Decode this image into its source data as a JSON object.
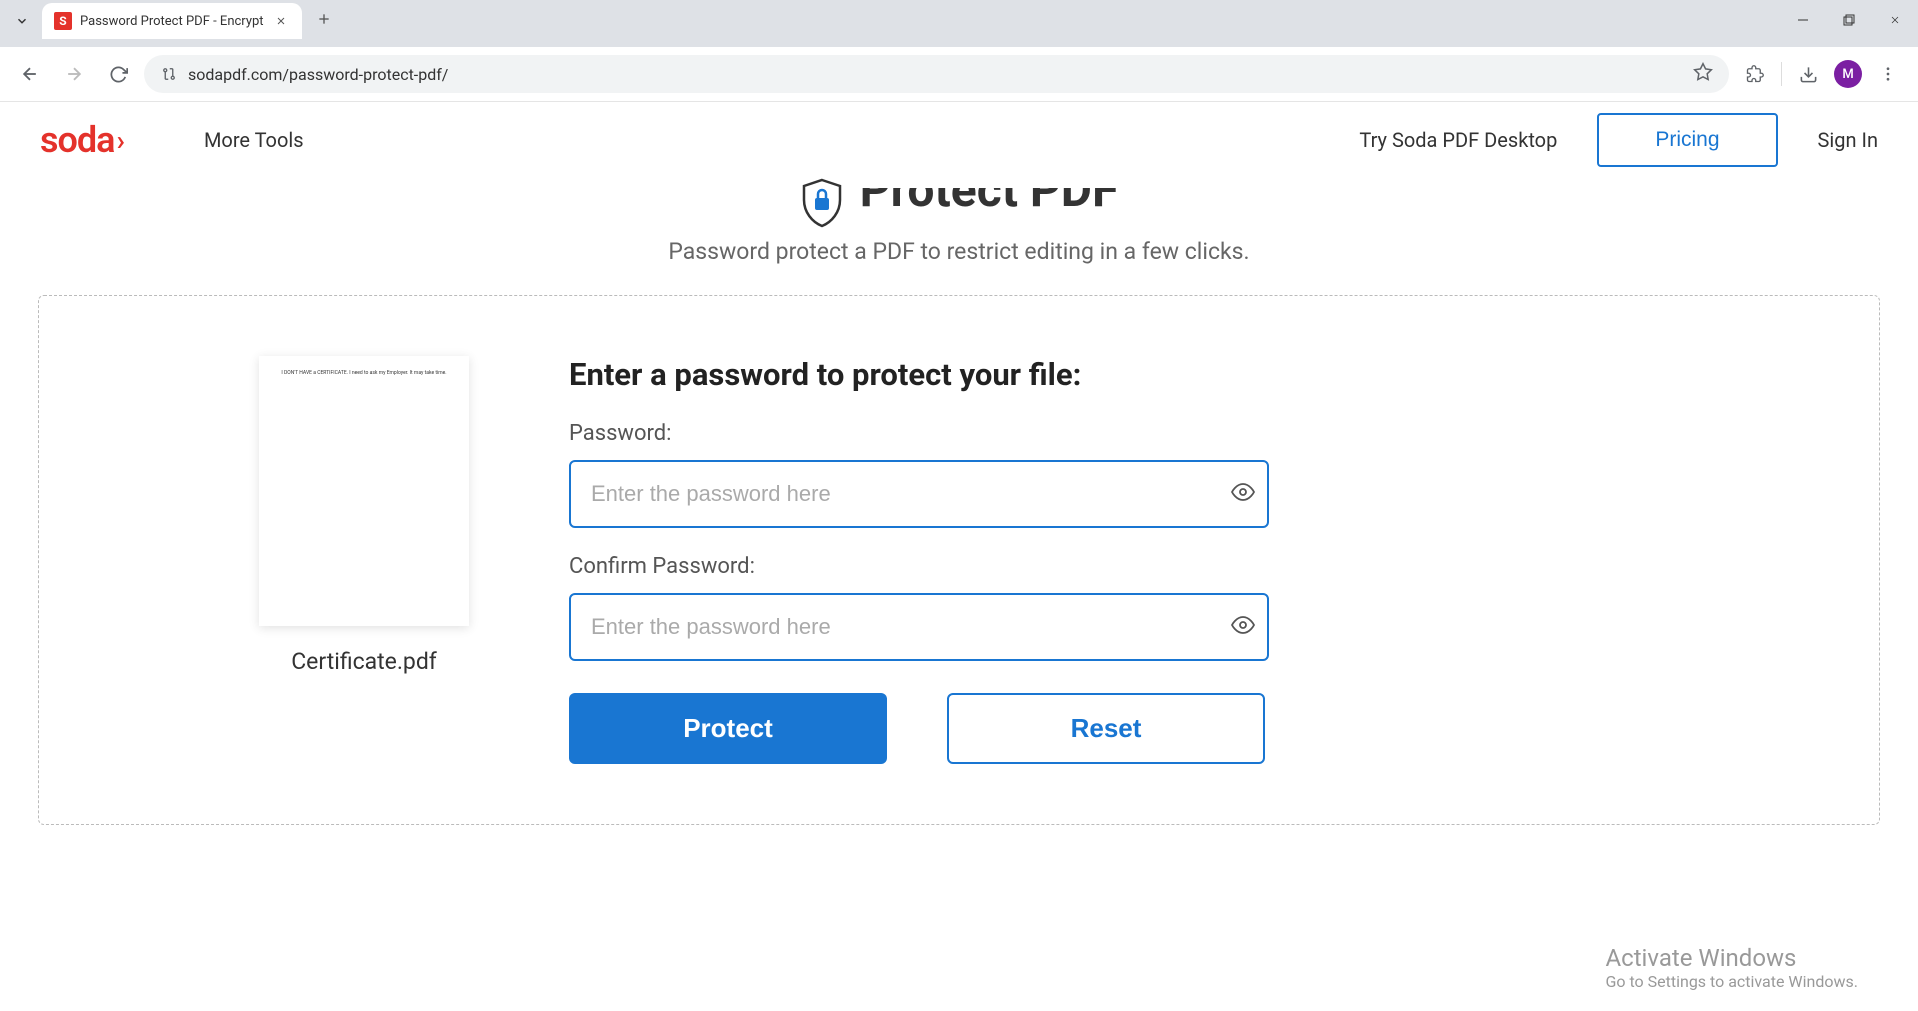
{
  "browser": {
    "tab_title": "Password Protect PDF - Encrypt",
    "tab_favicon_letter": "S",
    "url": "sodapdf.com/password-protect-pdf/",
    "avatar_letter": "M"
  },
  "header": {
    "logo_text": "soda",
    "more_tools": "More Tools",
    "try_desktop": "Try Soda PDF Desktop",
    "pricing": "Pricing",
    "signin": "Sign In"
  },
  "hero": {
    "title": "Protect PDF",
    "subtitle": "Password protect a PDF to restrict editing in a few clicks."
  },
  "preview": {
    "filename": "Certificate.pdf",
    "thumbnail_text": "I DON'T HAVE a CERTIFICATE. I need to ask my Employer. It may take time."
  },
  "form": {
    "title": "Enter a password to protect your file:",
    "password_label": "Password:",
    "password_placeholder": "Enter the password here",
    "confirm_label": "Confirm Password:",
    "confirm_placeholder": "Enter the password here",
    "protect_button": "Protect",
    "reset_button": "Reset"
  },
  "watermark": {
    "title": "Activate Windows",
    "subtitle": "Go to Settings to activate Windows."
  }
}
